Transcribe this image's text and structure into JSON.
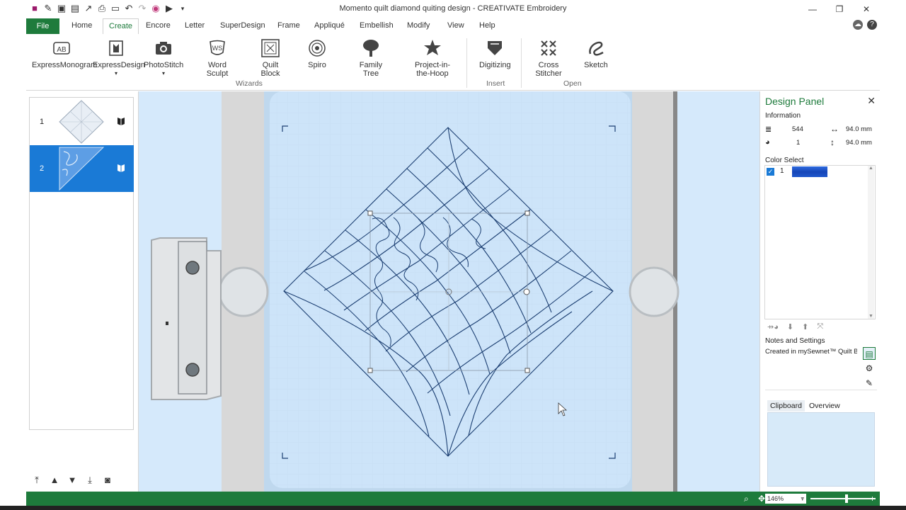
{
  "window": {
    "title": "Momento quilt diamond quiting design - CREATIVATE Embroidery",
    "qat_icons": [
      "app-logo-icon",
      "new-icon",
      "save-icon",
      "save-as-icon",
      "export-icon",
      "print-icon",
      "page-icon",
      "undo-icon",
      "redo-icon",
      "color-wheel-icon",
      "play-icon",
      "dropdown-icon"
    ]
  },
  "tabs": {
    "file": "File",
    "items": [
      "Home",
      "Create",
      "Encore",
      "Letter",
      "SuperDesign",
      "Frame",
      "Appliqué",
      "Embellish",
      "Modify",
      "View",
      "Help"
    ],
    "active": "Create"
  },
  "ribbon": {
    "buttons": [
      {
        "label": "ExpressMonogram",
        "icon": "monogram-icon"
      },
      {
        "label": "ExpressDesign",
        "icon": "express-design-icon"
      },
      {
        "label": "PhotoStitch",
        "icon": "camera-icon"
      },
      {
        "label": "Word\nSculpt",
        "icon": "word-sculpt-icon"
      },
      {
        "label": "Quilt\nBlock",
        "icon": "quilt-block-icon"
      },
      {
        "label": "Spiro",
        "icon": "spiro-icon"
      },
      {
        "label": "Family\nTree",
        "icon": "tree-icon"
      },
      {
        "label": "Project-in-\nthe-Hoop",
        "icon": "project-hoop-icon"
      },
      {
        "label": "Digitizing",
        "icon": "digitizing-icon"
      },
      {
        "label": "Cross\nStitcher",
        "icon": "cross-stitch-icon"
      },
      {
        "label": "Sketch",
        "icon": "sketch-icon"
      }
    ],
    "groups": {
      "wizards": "Wizards",
      "insert": "Insert",
      "open": "Open"
    }
  },
  "design_list": {
    "items": [
      {
        "num": "1",
        "selected": false
      },
      {
        "num": "2",
        "selected": true
      }
    ]
  },
  "design_panel": {
    "title": "Design Panel",
    "information_label": "Information",
    "stitches": "544",
    "width": "94.0 mm",
    "colors": "1",
    "height": "94.0 mm",
    "color_select_label": "Color Select",
    "color_entry": {
      "num": "1",
      "checked": true,
      "color": "#1646b8"
    },
    "notes_label": "Notes and Settings",
    "notes_text": "Created in mySewnet™ Quilt Blo",
    "clipboard_tab": "Clipboard",
    "overview_tab": "Overview"
  },
  "status": {
    "zoom": "146%"
  },
  "colors": {
    "accent_green": "#1e7b3c",
    "selection_blue": "#1a7ad6",
    "canvas_bg": "#d5e9fb",
    "stitch_line": "#1c3f72"
  }
}
